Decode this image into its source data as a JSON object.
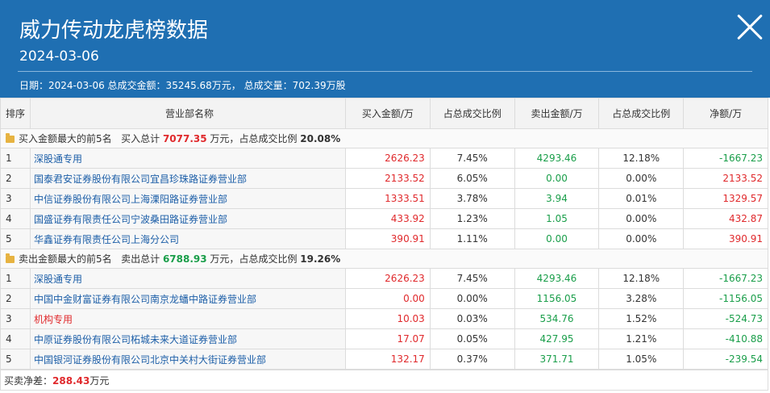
{
  "header": {
    "title": "威力传动龙虎榜数据",
    "date": "2024-03-06",
    "summary": "日期：2024-03-06 总成交金额：35245.68万元， 总成交量：702.39万股"
  },
  "columns": [
    "排序",
    "营业部名称",
    "买入金额/万",
    "占总成交比例",
    "卖出金额/万",
    "占总成交比例",
    "净额/万"
  ],
  "buy_section": {
    "label": "买入金额最大的前5名",
    "total_label": "买入总计",
    "total": "7077.35",
    "unit": "万元，",
    "ratio_label": "占总成交比例",
    "ratio": "20.08%",
    "rows": [
      {
        "rank": "1",
        "name": "深股通专用",
        "buy": "2626.23",
        "buy_pct": "7.45%",
        "sell": "4293.46",
        "sell_pct": "12.18%",
        "net": "-1667.23",
        "net_color": "green",
        "name_color": "blue"
      },
      {
        "rank": "2",
        "name": "国泰君安证券股份有限公司宜昌珍珠路证券营业部",
        "buy": "2133.52",
        "buy_pct": "6.05%",
        "sell": "0.00",
        "sell_pct": "0.00%",
        "net": "2133.52",
        "net_color": "red",
        "name_color": "blue"
      },
      {
        "rank": "3",
        "name": "中信证券股份有限公司上海溧阳路证券营业部",
        "buy": "1333.51",
        "buy_pct": "3.78%",
        "sell": "3.94",
        "sell_pct": "0.01%",
        "net": "1329.57",
        "net_color": "red",
        "name_color": "blue"
      },
      {
        "rank": "4",
        "name": "国盛证券有限责任公司宁波桑田路证券营业部",
        "buy": "433.92",
        "buy_pct": "1.23%",
        "sell": "1.05",
        "sell_pct": "0.00%",
        "net": "432.87",
        "net_color": "red",
        "name_color": "blue"
      },
      {
        "rank": "5",
        "name": "华鑫证券有限责任公司上海分公司",
        "buy": "390.91",
        "buy_pct": "1.11%",
        "sell": "0.00",
        "sell_pct": "0.00%",
        "net": "390.91",
        "net_color": "red",
        "name_color": "blue"
      }
    ]
  },
  "sell_section": {
    "label": "卖出金额最大的前5名",
    "total_label": "卖出总计",
    "total": "6788.93",
    "unit": "万元，",
    "ratio_label": "占总成交比例",
    "ratio": "19.26%",
    "rows": [
      {
        "rank": "1",
        "name": "深股通专用",
        "buy": "2626.23",
        "buy_pct": "7.45%",
        "sell": "4293.46",
        "sell_pct": "12.18%",
        "net": "-1667.23",
        "net_color": "green",
        "name_color": "blue"
      },
      {
        "rank": "2",
        "name": "中国中金财富证券有限公司南京龙蟠中路证券营业部",
        "buy": "0.00",
        "buy_pct": "0.00%",
        "sell": "1156.05",
        "sell_pct": "3.28%",
        "net": "-1156.05",
        "net_color": "green",
        "name_color": "blue"
      },
      {
        "rank": "3",
        "name": "机构专用",
        "buy": "10.03",
        "buy_pct": "0.03%",
        "sell": "534.76",
        "sell_pct": "1.52%",
        "net": "-524.73",
        "net_color": "green",
        "name_color": "red"
      },
      {
        "rank": "4",
        "name": "中原证券股份有限公司柘城未来大道证券营业部",
        "buy": "17.07",
        "buy_pct": "0.05%",
        "sell": "427.95",
        "sell_pct": "1.21%",
        "net": "-410.88",
        "net_color": "green",
        "name_color": "blue"
      },
      {
        "rank": "5",
        "name": "中国银河证券股份有限公司北京中关村大街证券营业部",
        "buy": "132.17",
        "buy_pct": "0.37%",
        "sell": "371.71",
        "sell_pct": "1.05%",
        "net": "-239.54",
        "net_color": "green",
        "name_color": "blue"
      }
    ]
  },
  "footer": {
    "net_label": "买卖净差：",
    "net_value": "288.43",
    "net_unit": "万元"
  },
  "colors": {
    "header_bg": "#1f6fb2",
    "red": "#e0292c",
    "green": "#1a9e4a",
    "link": "#1d5fa8"
  },
  "icons": {
    "close": "close-icon",
    "section": "folder-icon"
  }
}
